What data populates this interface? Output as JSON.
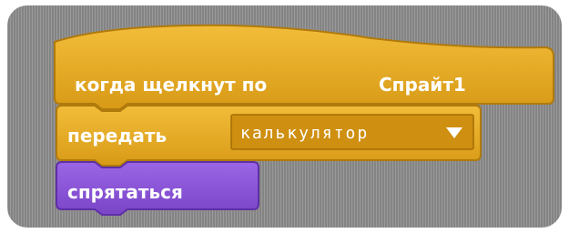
{
  "scripts_area": {
    "background_color": "#8f8f8f"
  },
  "blocks": {
    "hat": {
      "label": "когда щелкнут по",
      "sprite_name": "Спрайт1",
      "color": "#e6a822"
    },
    "broadcast": {
      "label": "передать",
      "message": "калькулятор",
      "dropdown_icon": "triangle-down-icon",
      "color": "#e6a822"
    },
    "hide": {
      "label": "спрятаться",
      "color": "#8a55d7"
    }
  }
}
